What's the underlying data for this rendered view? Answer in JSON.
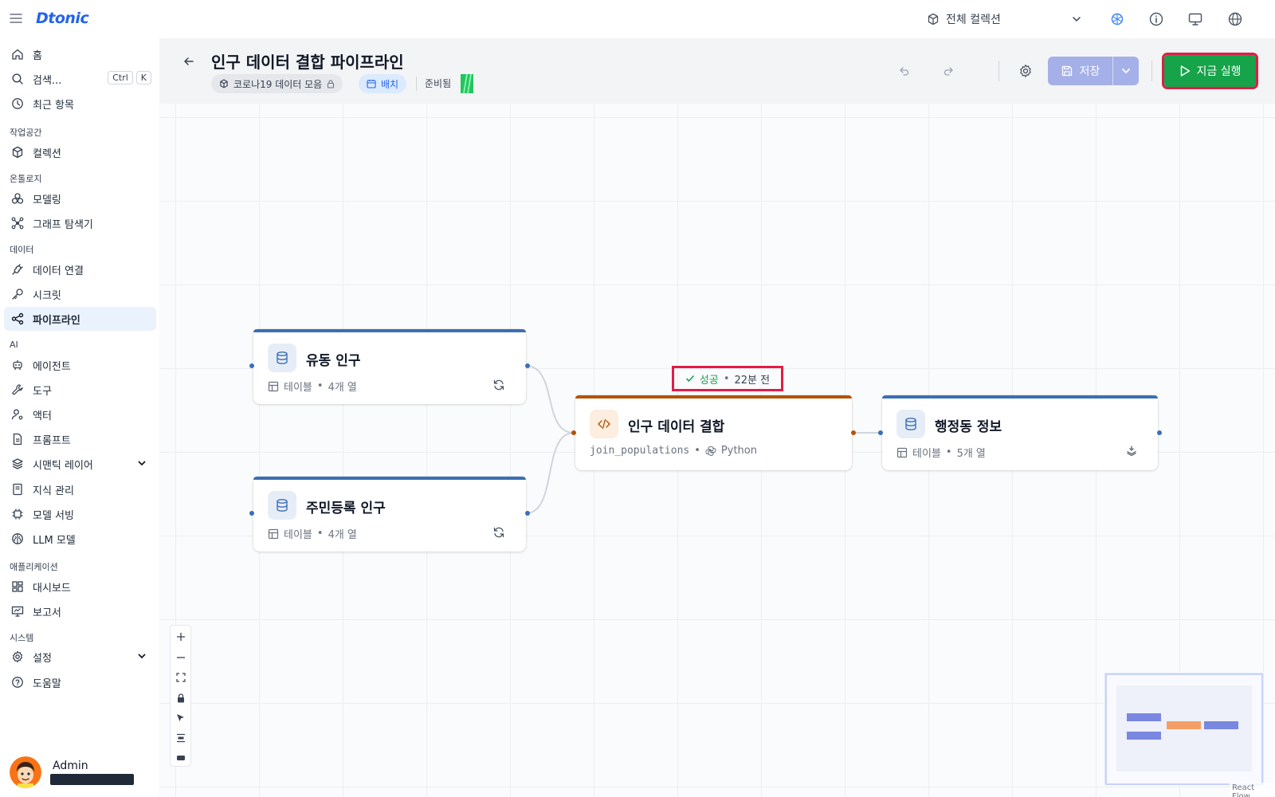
{
  "app": {
    "logo": "Dtonic"
  },
  "topbar": {
    "collection_selector": "전체 컬렉션",
    "icons": [
      "ai-assistant-icon",
      "info-icon",
      "monitor-icon",
      "globe-icon"
    ]
  },
  "sidebar": {
    "home": "홈",
    "search": {
      "label": "검색...",
      "kbd1": "Ctrl",
      "kbd2": "K"
    },
    "recent": "최근 항목",
    "sections": {
      "workspace": "작업공간",
      "ontology": "온톨로지",
      "data": "데이터",
      "ai": "AI",
      "apps": "애플리케이션",
      "system": "시스템"
    },
    "items": {
      "collection": "컬렉션",
      "modeling": "모델링",
      "graph_explorer": "그래프 탐색기",
      "data_connection": "데이터 연결",
      "secret": "시크릿",
      "pipeline": "파이프라인",
      "agent": "에이전트",
      "tool": "도구",
      "actor": "액터",
      "prompt": "프롬프트",
      "semantic_layer": "시맨틱 레이어",
      "knowledge": "지식 관리",
      "model_serving": "모델 서빙",
      "llm_model": "LLM 모델",
      "dashboard": "대시보드",
      "report": "보고서",
      "settings": "설정",
      "help": "도움말"
    },
    "active": "pipeline",
    "user": {
      "name": "Admin"
    }
  },
  "header": {
    "title": "인구 데이터 결합 파이프라인",
    "collection_chip": "코로나19 데이터 모음",
    "type_chip": "배치",
    "status": "준비됨",
    "save_label": "저장",
    "run_label": "지금 실행"
  },
  "canvas": {
    "nodes": [
      {
        "id": "n1",
        "title": "유동 인구",
        "kind": "테이블",
        "meta": "4개 열",
        "action": "refresh-icon"
      },
      {
        "id": "n2",
        "title": "주민등록 인구",
        "kind": "테이블",
        "meta": "4개 열",
        "action": "refresh-icon"
      },
      {
        "id": "n3",
        "title": "인구 데이터 결합",
        "kind": "join_populations",
        "meta": "Python",
        "action": ""
      },
      {
        "id": "n4",
        "title": "행정동 정보",
        "kind": "테이블",
        "meta": "5개 열",
        "action": "layers-icon"
      }
    ],
    "run_status": {
      "state": "성공",
      "time": "22분 전"
    },
    "credit": "React Flow"
  },
  "colors": {
    "accent": "#2563eb",
    "source_node": "#3b6fb6",
    "transform_node": "#b45309",
    "success": "#16a34a",
    "run_button": "#16a34a",
    "save_button": "#a5b0e8"
  }
}
